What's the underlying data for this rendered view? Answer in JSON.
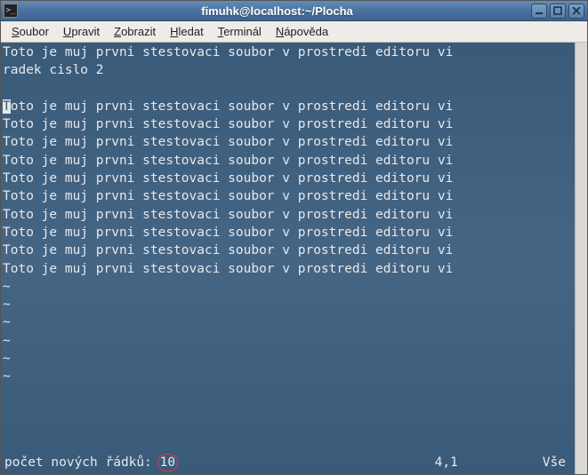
{
  "titlebar": {
    "title": "fimuhk@localhost:~/Plocha"
  },
  "menubar": {
    "items": [
      {
        "u": "S",
        "rest": "oubor"
      },
      {
        "u": "U",
        "rest": "pravit"
      },
      {
        "u": "Z",
        "rest": "obrazit"
      },
      {
        "u": "H",
        "rest": "ledat"
      },
      {
        "u": "T",
        "rest": "erminál"
      },
      {
        "u": "N",
        "rest": "ápověda"
      }
    ]
  },
  "editor": {
    "lines": [
      "Toto je muj prvni stestovaci soubor v prostredi editoru vi",
      "radek cislo 2",
      "",
      "Toto je muj prvni stestovaci soubor v prostredi editoru vi",
      "Toto je muj prvni stestovaci soubor v prostredi editoru vi",
      "Toto je muj prvni stestovaci soubor v prostredi editoru vi",
      "Toto je muj prvni stestovaci soubor v prostredi editoru vi",
      "Toto je muj prvni stestovaci soubor v prostredi editoru vi",
      "Toto je muj prvni stestovaci soubor v prostredi editoru vi",
      "Toto je muj prvni stestovaci soubor v prostredi editoru vi",
      "Toto je muj prvni stestovaci soubor v prostredi editoru vi",
      "Toto je muj prvni stestovaci soubor v prostredi editoru vi",
      "Toto je muj prvni stestovaci soubor v prostredi editoru vi"
    ],
    "tilde_count": 6,
    "cursor_line_index": 3
  },
  "status": {
    "message_prefix": "počet nových řádků: ",
    "message_count": "10",
    "position": "4,1",
    "scroll": "Vše"
  }
}
